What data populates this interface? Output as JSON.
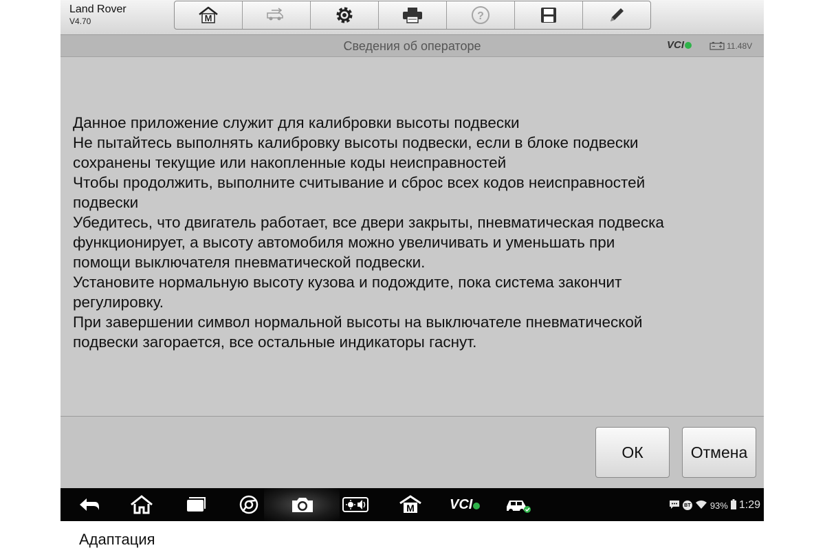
{
  "app": {
    "name": "Land Rover",
    "version": "V4.70"
  },
  "toolbar": {
    "items": [
      "home-m-icon",
      "vehicle-swap-icon",
      "gear-icon",
      "printer-icon",
      "help-icon",
      "save-icon",
      "pencil-icon"
    ]
  },
  "titlebar": {
    "title": "Сведения об операторе",
    "vci": "VCI",
    "voltage": "11.48V"
  },
  "message": {
    "lines": [
      "Данное приложение служит для калибровки высоты подвески",
      "Не пытайтесь выполнять калибровку высоты подвески, если в блоке подвески",
      "сохранены текущие или накопленные коды неисправностей",
      "Чтобы продолжить, выполните считывание и сброс всех кодов неисправностей",
      "подвески",
      "Убедитесь, что двигатель работает, все двери закрыты, пневматическая подвеска",
      "функционирует, а высоту автомобиля можно увеличивать и уменьшать при",
      "помощи выключателя пневматической подвески.",
      "Установите нормальную высоту кузова и подождите, пока система закончит",
      "регулировку.",
      "При завершении символ нормальной высоты на выключателе пневматической",
      "подвески загорается, все остальные индикаторы гаснут."
    ]
  },
  "buttons": {
    "ok": "ОК",
    "cancel": "Отмена"
  },
  "navbar": {
    "vci": "VCI",
    "bt": "BT",
    "battery": "93%",
    "time": "1:29"
  },
  "colors": {
    "accent_green": "#2fb34a"
  },
  "caption": "Адаптация"
}
